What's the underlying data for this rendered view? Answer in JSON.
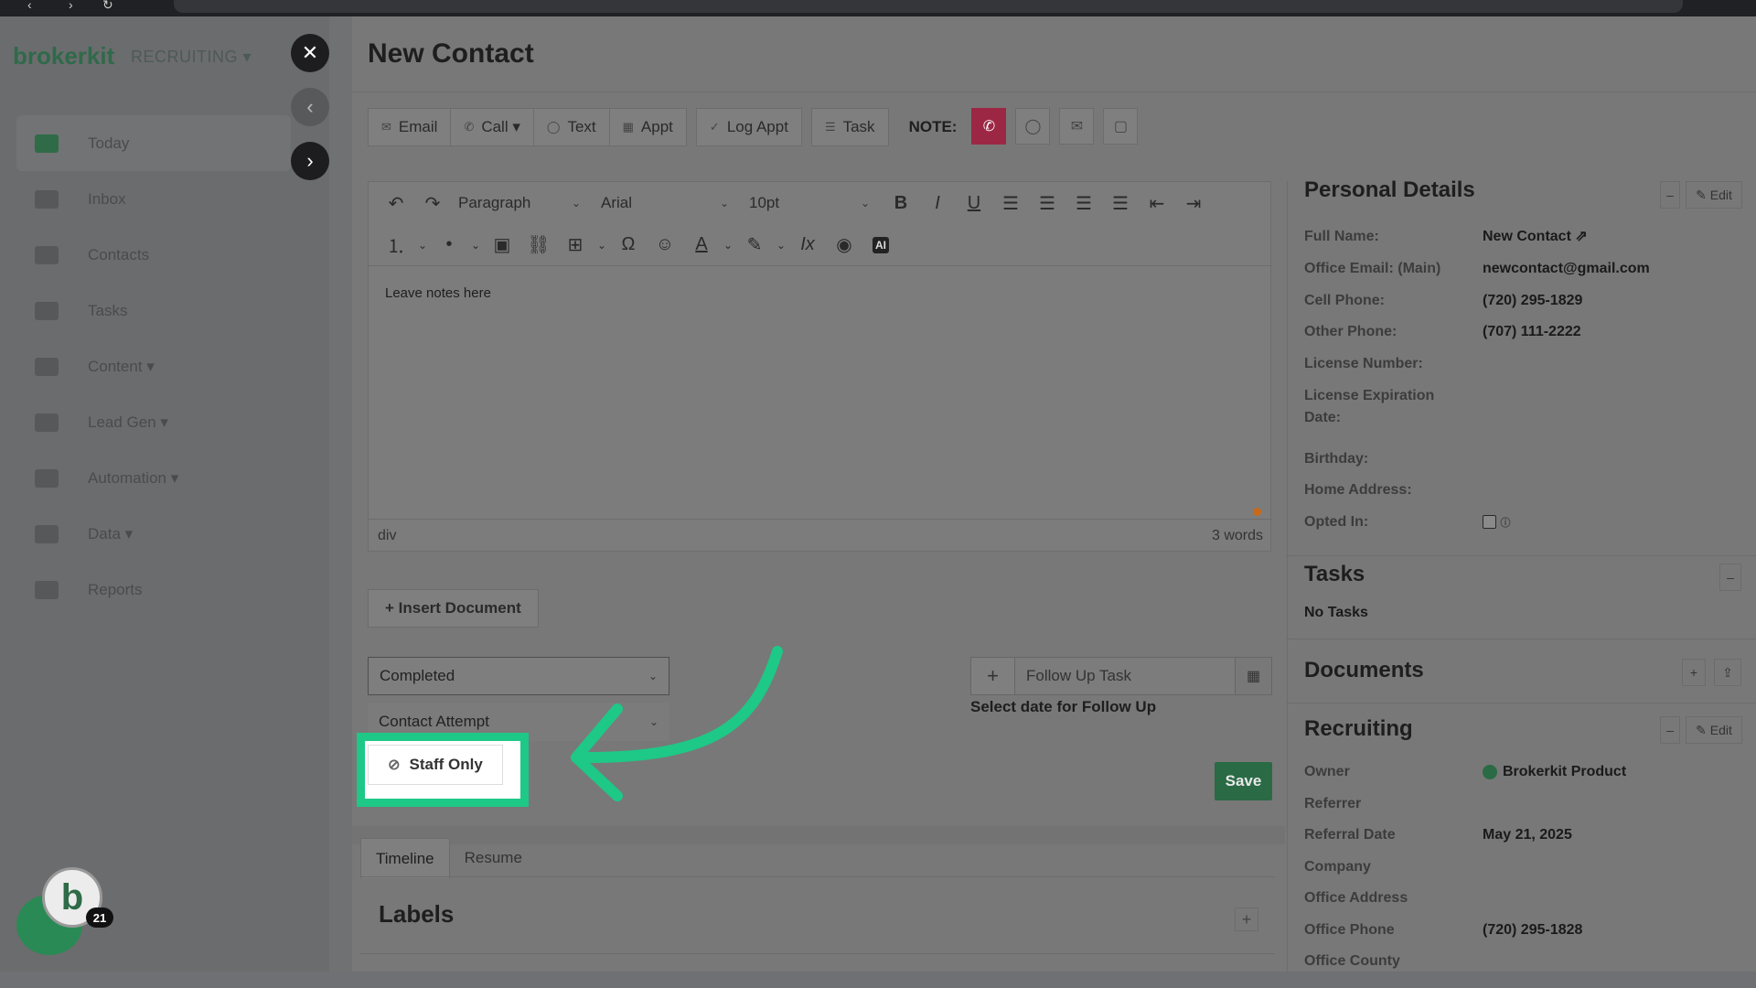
{
  "app": {
    "brand": "brokerkit",
    "brand_sub": "RECRUITING ▾",
    "nav": [
      {
        "label": "Today",
        "icon": "calendar-icon",
        "active": true
      },
      {
        "label": "Inbox",
        "icon": "inbox-icon"
      },
      {
        "label": "Contacts",
        "icon": "contacts-icon"
      },
      {
        "label": "Tasks",
        "icon": "tasks-icon"
      },
      {
        "label": "Content ▾",
        "icon": "content-icon"
      },
      {
        "label": "Lead Gen ▾",
        "icon": "lead-gen-icon"
      },
      {
        "label": "Automation ▾",
        "icon": "automation-icon"
      },
      {
        "label": "Data ▾",
        "icon": "data-icon"
      },
      {
        "label": "Reports",
        "icon": "reports-icon"
      }
    ],
    "chat_badge": "21"
  },
  "modal": {
    "title": "New Contact",
    "actions": {
      "email": "Email",
      "call": "Call ▾",
      "text": "Text",
      "appt": "Appt",
      "log_appt": "Log Appt",
      "task": "Task",
      "note_label": "NOTE:"
    },
    "editor": {
      "paragraph": "Paragraph",
      "font": "Arial",
      "size": "10pt",
      "placeholder": "Leave notes here",
      "path": "div",
      "word_count": "3 words"
    },
    "insert_document": "+ Insert Document",
    "status_select": "Completed",
    "type_select": "Contact Attempt",
    "follow_up_placeholder": "Follow Up Task",
    "follow_up_hint": "Select date for Follow Up",
    "staff_only": "Staff Only",
    "save": "Save",
    "tabs": [
      "Timeline",
      "Resume"
    ],
    "labels_title": "Labels"
  },
  "details": {
    "personal_title": "Personal Details",
    "edit": "Edit",
    "fields": [
      {
        "k": "Full Name:",
        "v": "New Contact"
      },
      {
        "k": "Office Email: (Main)",
        "v": "newcontact@gmail.com"
      },
      {
        "k": "Cell Phone:",
        "v": "(720) 295-1829"
      },
      {
        "k": "Other Phone:",
        "v": "(707) 111-2222"
      },
      {
        "k": "License Number:",
        "v": ""
      },
      {
        "k": "License Expiration Date:",
        "v": ""
      },
      {
        "k": "Birthday:",
        "v": ""
      },
      {
        "k": "Home Address:",
        "v": ""
      },
      {
        "k": "Opted In:",
        "v": ""
      }
    ],
    "tasks_title": "Tasks",
    "no_tasks": "No Tasks",
    "documents_title": "Documents",
    "recruiting_title": "Recruiting",
    "recruiting": [
      {
        "k": "Owner",
        "v": "Brokerkit Product"
      },
      {
        "k": "Referrer",
        "v": ""
      },
      {
        "k": "Referral Date",
        "v": "May 21, 2025"
      },
      {
        "k": "Company",
        "v": ""
      },
      {
        "k": "Office Address",
        "v": ""
      },
      {
        "k": "Office Phone",
        "v": "(720) 295-1828"
      },
      {
        "k": "Office County",
        "v": ""
      }
    ]
  },
  "colors": {
    "highlight": "#1ec887",
    "brand_green": "#2a6a45",
    "note_active": "#9c2744"
  }
}
